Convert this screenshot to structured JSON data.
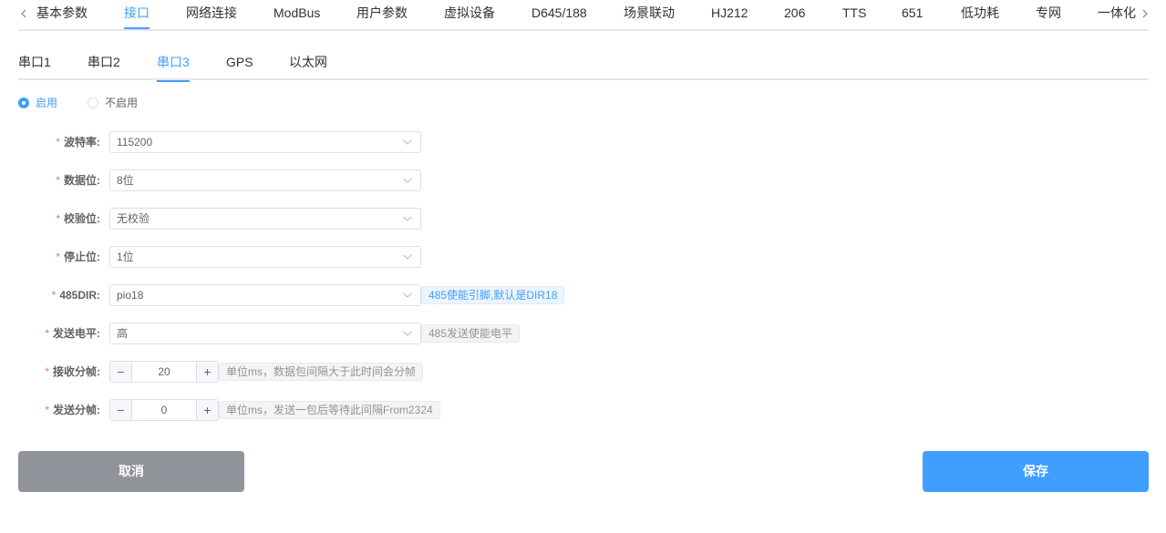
{
  "top_tabs": [
    {
      "label": "基本参数"
    },
    {
      "label": "接口"
    },
    {
      "label": "网络连接"
    },
    {
      "label": "ModBus"
    },
    {
      "label": "用户参数"
    },
    {
      "label": "虚拟设备"
    },
    {
      "label": "D645/188"
    },
    {
      "label": "场景联动"
    },
    {
      "label": "HJ212"
    },
    {
      "label": "206"
    },
    {
      "label": "TTS"
    },
    {
      "label": "651"
    },
    {
      "label": "低功耗"
    },
    {
      "label": "专网"
    },
    {
      "label": "一体化"
    }
  ],
  "active_top_tab": "接口",
  "sub_tabs": [
    {
      "label": "串口1"
    },
    {
      "label": "串口2"
    },
    {
      "label": "串口3"
    },
    {
      "label": "GPS"
    },
    {
      "label": "以太网"
    }
  ],
  "active_sub_tab": "串口3",
  "enable": {
    "on_label": "启用",
    "off_label": "不启用",
    "selected": "启用"
  },
  "form": {
    "required_mark": "*",
    "baud_rate": {
      "label": "波特率:",
      "value": "115200"
    },
    "data_bits": {
      "label": "数据位:",
      "value": "8位"
    },
    "parity": {
      "label": "校验位:",
      "value": "无校验"
    },
    "stop_bits": {
      "label": "停止位:",
      "value": "1位"
    },
    "dir485": {
      "label": "485DIR:",
      "value": "pio18",
      "hint": "485使能引脚,默认是DIR18"
    },
    "send_level": {
      "label": "发送电平:",
      "value": "高",
      "hint": "485发送使能电平"
    },
    "recv_frame": {
      "label": "接收分帧:",
      "value": "20",
      "hint": "单位ms，数据包间隔大于此时间会分帧"
    },
    "send_frame": {
      "label": "发送分帧:",
      "value": "0",
      "hint": "单位ms，发送一包后等待此间隔From2324"
    }
  },
  "stepper": {
    "minus": "−",
    "plus": "+"
  },
  "actions": {
    "cancel": "取消",
    "save": "保存"
  },
  "colors": {
    "accent": "#409eff",
    "cancel_bg": "#909399",
    "required": "#f56c6c"
  }
}
